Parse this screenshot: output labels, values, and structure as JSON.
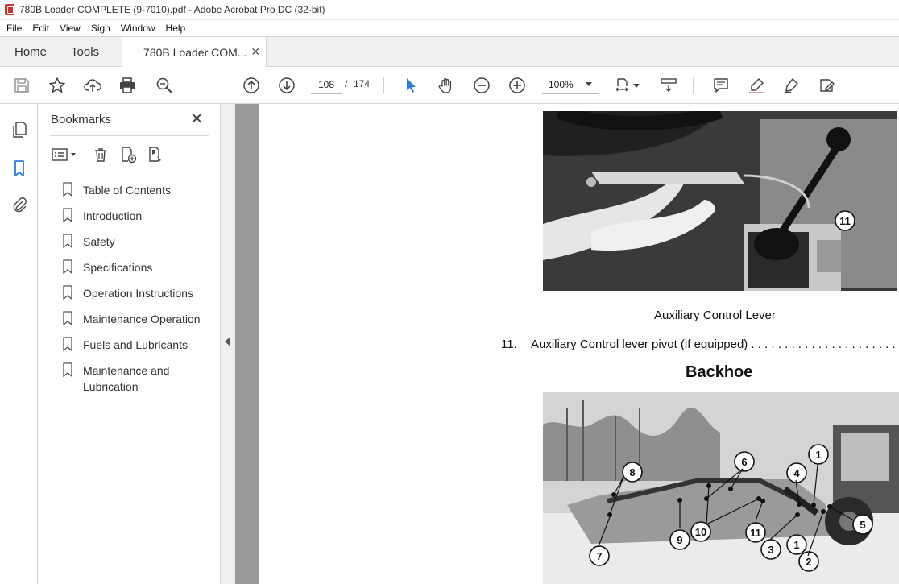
{
  "window": {
    "title": "780B Loader COMPLETE (9-7010).pdf - Adobe Acrobat Pro DC (32-bit)"
  },
  "menu": [
    "File",
    "Edit",
    "View",
    "Sign",
    "Window",
    "Help"
  ],
  "tabs": {
    "home": "Home",
    "tools": "Tools",
    "document": "780B Loader COM..."
  },
  "toolbar": {
    "page_current": "108",
    "page_separator": "/",
    "page_total": "174",
    "zoom": "100%"
  },
  "bookmarks": {
    "header": "Bookmarks",
    "items": [
      "Table of Contents",
      "Introduction",
      "Safety",
      "Specifications",
      "Operation Instructions",
      "Maintenance Operation",
      "Fuels and Lubricants",
      "Maintenance and Lubrication"
    ]
  },
  "page": {
    "caption": "Auxiliary Control Lever",
    "item_number": "11.",
    "item_text": "Auxiliary Control lever pivot (if equipped)",
    "item_leader": " . . . . . . . . . . . . . . . . . . . . . . . . . . . . . .",
    "section_heading": "Backhoe",
    "photo1_callouts": [
      "11"
    ],
    "photo2_callouts": [
      "8",
      "6",
      "4",
      "1",
      "5",
      "9",
      "10",
      "11",
      "3",
      "1",
      "2",
      "7"
    ]
  },
  "colors": {
    "accent": "#2a7de1",
    "pdf_red": "#d4312a"
  }
}
